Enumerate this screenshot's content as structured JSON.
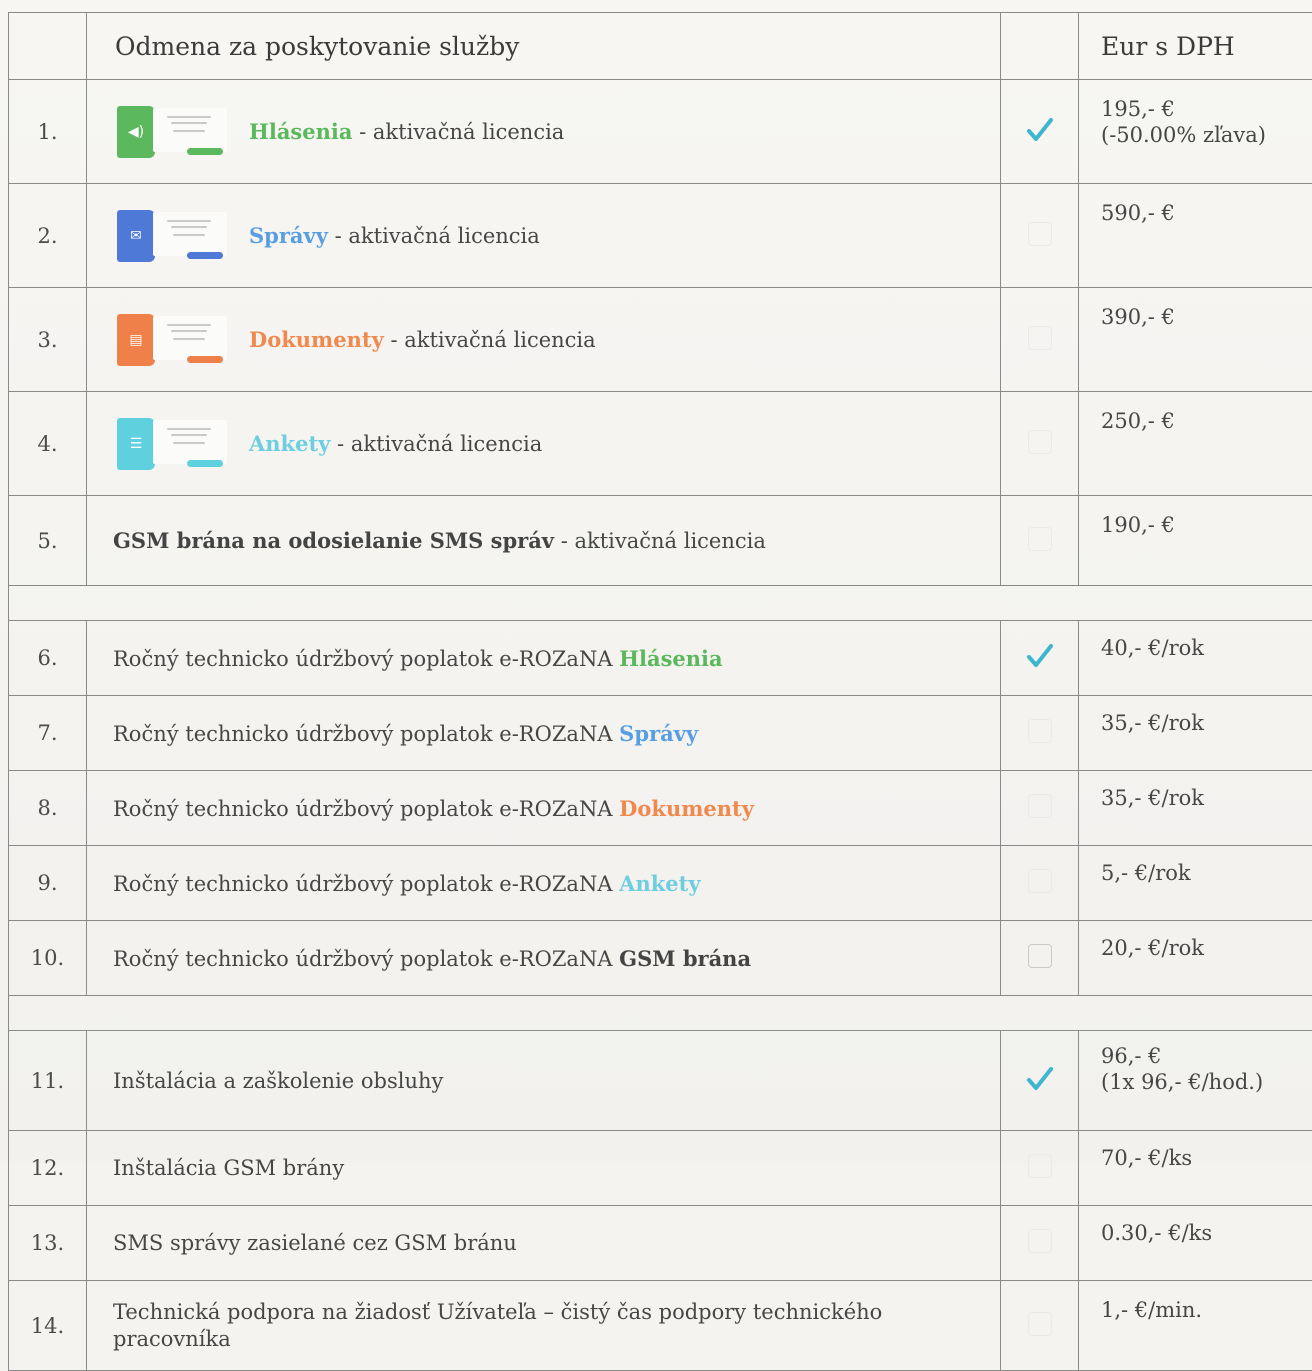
{
  "header": {
    "description": "Odmena za poskytovanie služby",
    "price": "Eur s DPH"
  },
  "licenses": [
    {
      "num": "1.",
      "name": "Hlásenia",
      "suffix": " - aktivačná licencia",
      "color": "#5cb85c",
      "icon": "speaker-icon",
      "checked": true,
      "price_line1": "195,- €",
      "price_line2": "(-50.00% zľava)"
    },
    {
      "num": "2.",
      "name": "Správy",
      "suffix": " - aktivačná licencia",
      "color": "#5a9ee2",
      "icon": "envelope-icon",
      "checked": false,
      "price_line1": "590,- €",
      "price_line2": ""
    },
    {
      "num": "3.",
      "name": "Dokumenty",
      "suffix": " - aktivačná licencia",
      "color": "#f0894d",
      "icon": "document-icon",
      "checked": false,
      "price_line1": "390,- €",
      "price_line2": ""
    },
    {
      "num": "4.",
      "name": "Ankety",
      "suffix": " - aktivačná licencia",
      "color": "#6fcde0",
      "icon": "poll-icon",
      "checked": false,
      "price_line1": "250,- €",
      "price_line2": ""
    }
  ],
  "gsm_license": {
    "num": "5.",
    "name": "GSM brána na odosielanie SMS správ",
    "suffix": " - aktivačná licencia",
    "checked": false,
    "price": "190,- €"
  },
  "fees": [
    {
      "num": "6.",
      "prefix": "Ročný technicko údržbový poplatok e-ROZaNA ",
      "name": "Hlásenia",
      "color": "#5cb85c",
      "checked": true,
      "price": "40,- €/rok"
    },
    {
      "num": "7.",
      "prefix": "Ročný technicko údržbový poplatok e-ROZaNA ",
      "name": "Správy",
      "color": "#5a9ee2",
      "checked": false,
      "price": "35,- €/rok"
    },
    {
      "num": "8.",
      "prefix": "Ročný technicko údržbový poplatok e-ROZaNA ",
      "name": "Dokumenty",
      "color": "#f0894d",
      "checked": false,
      "price": "35,- €/rok"
    },
    {
      "num": "9.",
      "prefix": "Ročný technicko údržbový poplatok e-ROZaNA ",
      "name": "Ankety",
      "color": "#6fcde0",
      "checked": false,
      "price": "5,- €/rok"
    },
    {
      "num": "10.",
      "prefix": "Ročný technicko údržbový poplatok e-ROZaNA ",
      "name": "GSM brána",
      "color": "#444444",
      "checked": false,
      "price": "20,- €/rok"
    }
  ],
  "services": [
    {
      "num": "11.",
      "desc": "Inštalácia a zaškolenie obsluhy",
      "checked": true,
      "price_line1": "96,- €",
      "price_line2": "(1x 96,- €/hod.)"
    },
    {
      "num": "12.",
      "desc": "Inštalácia GSM brány",
      "checked": false,
      "price_line1": "70,- €/ks",
      "price_line2": ""
    },
    {
      "num": "13.",
      "desc": "SMS správy zasielané cez GSM bránu",
      "checked": false,
      "price_line1": "0.30,- €/ks",
      "price_line2": ""
    },
    {
      "num": "14.",
      "desc_line1": "Technická podpora na žiadosť Užívateľa – čistý čas podpory technického",
      "desc_line2": "pracovníka",
      "checked": false,
      "price_line1": "1,- €/min.",
      "price_line2": ""
    }
  ],
  "colors": {
    "check_mark": "#3fb6cf",
    "border": "#8a8a8a"
  }
}
